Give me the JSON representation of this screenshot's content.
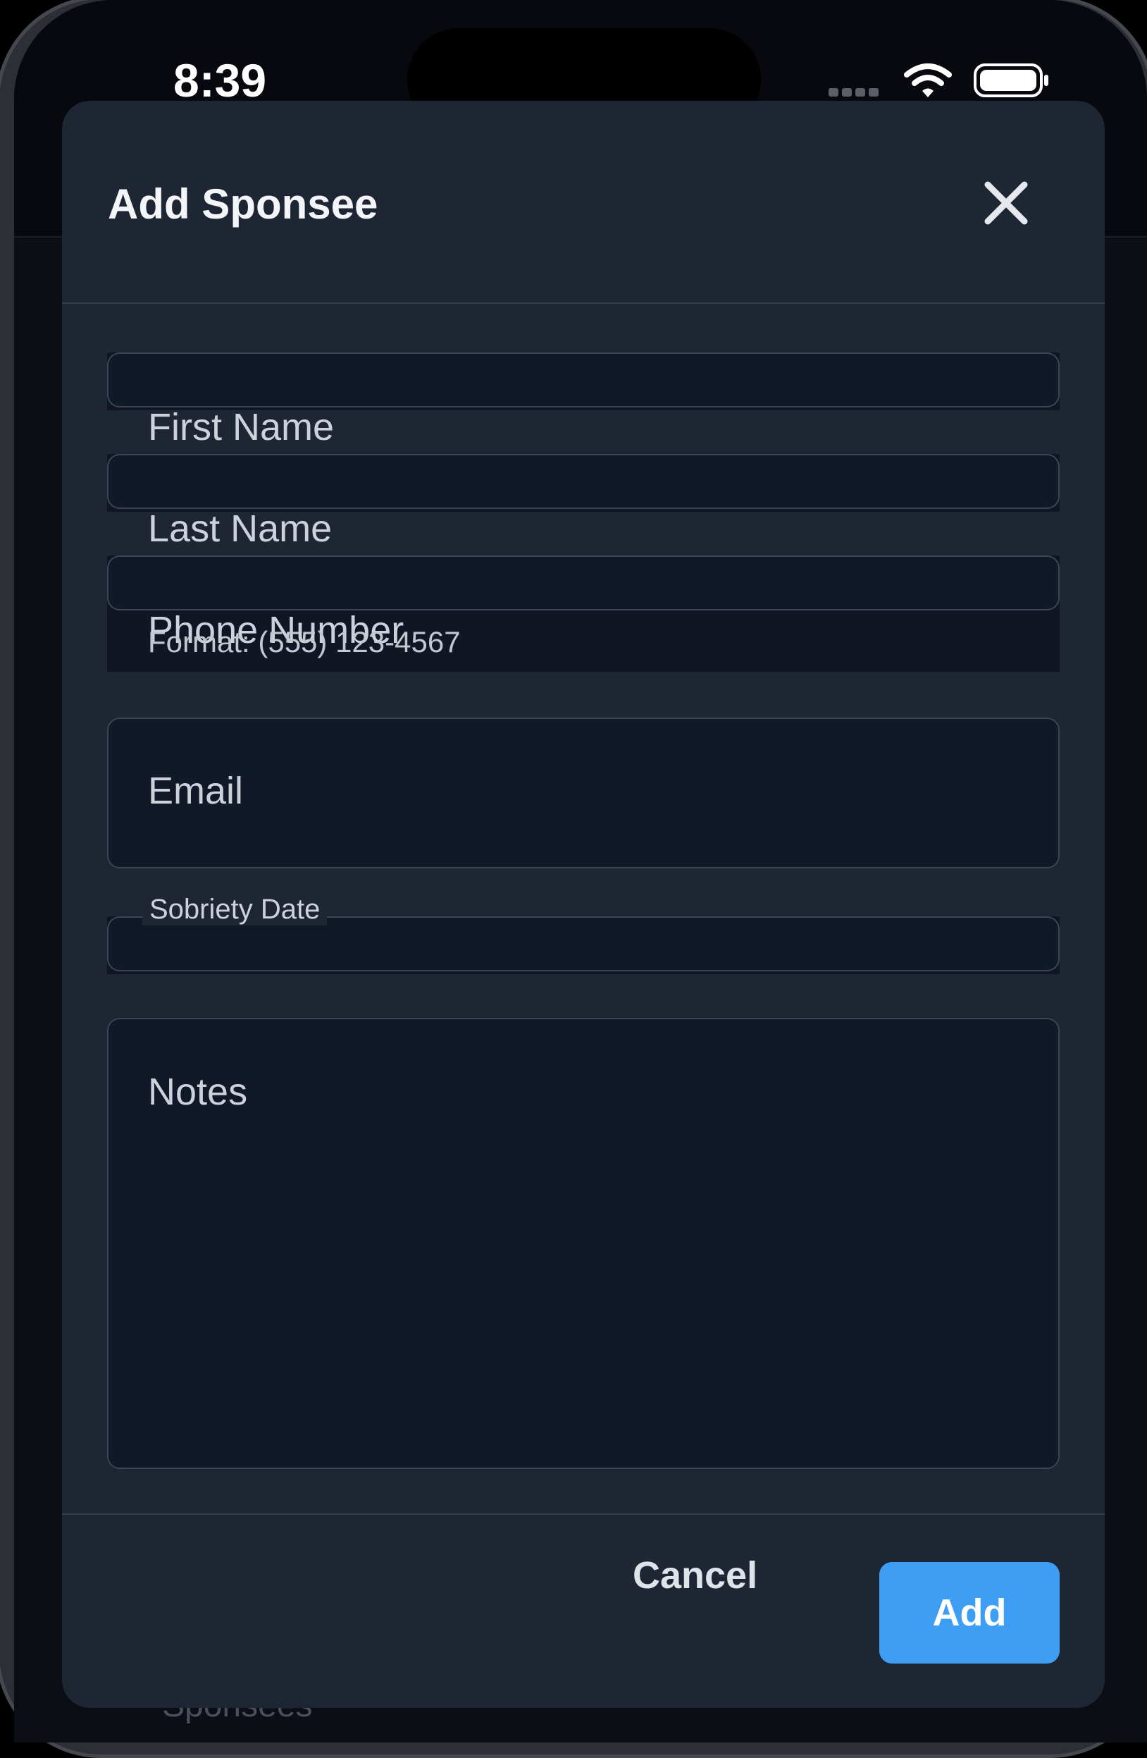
{
  "status_bar": {
    "time": "8:39"
  },
  "background": {
    "partial_text": "Sponsees"
  },
  "modal": {
    "title": "Add Sponsee",
    "fields": {
      "first_name": {
        "label": "First Name",
        "value": ""
      },
      "last_name": {
        "label": "Last Name",
        "value": ""
      },
      "phone": {
        "label": "Phone Number",
        "helper": "Format: (555) 123-4567",
        "value": ""
      },
      "email": {
        "label": "Email",
        "value": ""
      },
      "sobriety_date": {
        "label": "Sobriety Date",
        "value": ""
      },
      "notes": {
        "label": "Notes",
        "value": ""
      }
    },
    "actions": {
      "cancel_label": "Cancel",
      "add_label": "Add"
    }
  },
  "colors": {
    "modal_bg": "#1e2634",
    "field_bg": "#111827",
    "border": "#3c4556",
    "accent": "#3d9ef3",
    "text_primary": "#f3f5f8"
  },
  "icons": [
    "close-icon",
    "wifi-icon",
    "battery-icon",
    "signal-dots-icon"
  ]
}
